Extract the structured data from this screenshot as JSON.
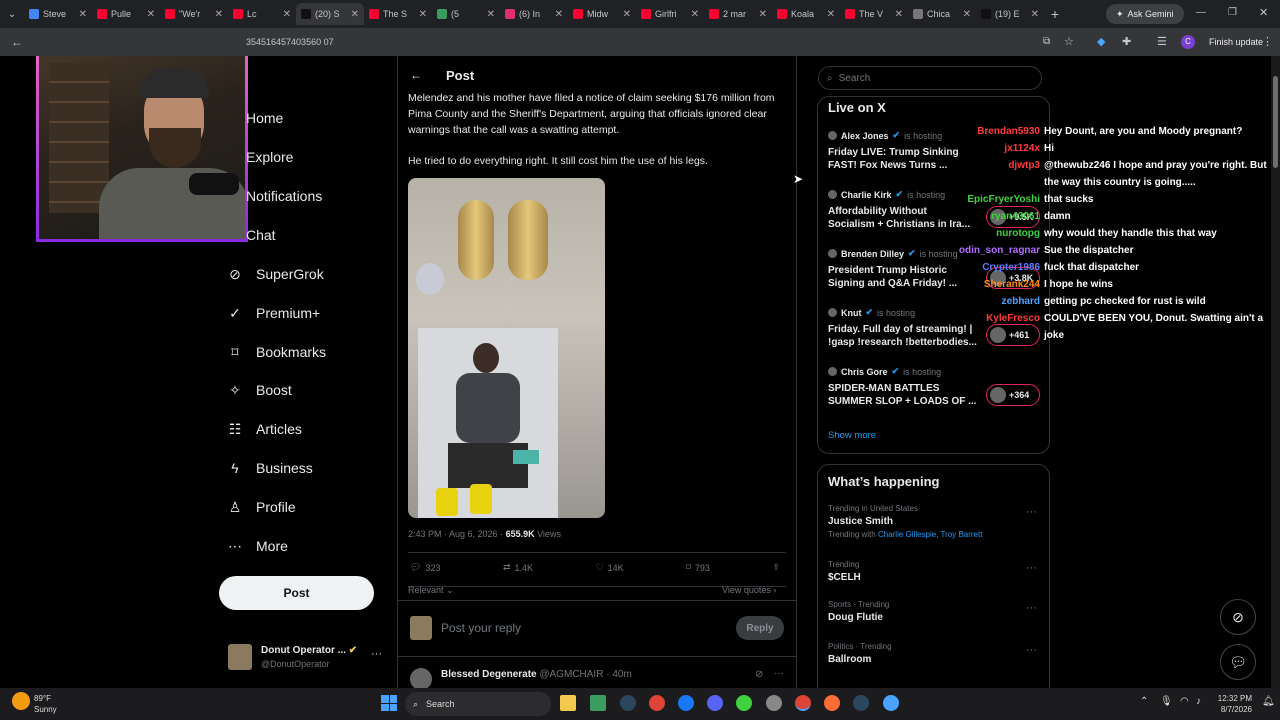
{
  "browser": {
    "tabs": [
      {
        "title": "Steve",
        "color": "#4285f4",
        "active": false
      },
      {
        "title": "Pulle",
        "color": "#ff0033",
        "active": false
      },
      {
        "title": "\"We'r",
        "color": "#ff0033",
        "active": false
      },
      {
        "title": "Lc",
        "color": "#ff0033",
        "active": false
      },
      {
        "title": "(20) S",
        "color": "#111111",
        "active": true
      },
      {
        "title": "The S",
        "color": "#ff0033",
        "active": false
      },
      {
        "title": "(5",
        "color": "#3a9d5d",
        "active": false
      },
      {
        "title": "(6) In",
        "color": "#e1306c",
        "active": false
      },
      {
        "title": "Midw",
        "color": "#ff0033",
        "active": false
      },
      {
        "title": "Girlfri",
        "color": "#ff0033",
        "active": false
      },
      {
        "title": "2 mar",
        "color": "#ff0033",
        "active": false
      },
      {
        "title": "Koala",
        "color": "#ff0033",
        "active": false
      },
      {
        "title": "The V",
        "color": "#ff0033",
        "active": false
      },
      {
        "title": "Chica",
        "color": "#777777",
        "active": false
      },
      {
        "title": "(19) E",
        "color": "#111111",
        "active": false
      }
    ],
    "ask_gemini": "Ask Gemini",
    "url": "354516457403560 07",
    "finish_update": "Finish update",
    "profile_initial": "C"
  },
  "sidebar": {
    "items": [
      {
        "label": "Home",
        "icon": "home-icon"
      },
      {
        "label": "Explore",
        "icon": "search-icon"
      },
      {
        "label": "Notifications",
        "icon": "bell-icon"
      },
      {
        "label": "Chat",
        "icon": "chat-icon"
      },
      {
        "label": "SuperGrok",
        "icon": "grok-icon"
      },
      {
        "label": "Premium+",
        "icon": "premium-icon"
      },
      {
        "label": "Bookmarks",
        "icon": "bookmark-icon"
      },
      {
        "label": "Boost",
        "icon": "boost-icon"
      },
      {
        "label": "Articles",
        "icon": "articles-icon"
      },
      {
        "label": "Business",
        "icon": "lightning-icon"
      },
      {
        "label": "Profile",
        "icon": "person-icon"
      },
      {
        "label": "More",
        "icon": "more-circle-icon"
      }
    ],
    "post_button": "Post",
    "account": {
      "name": "Donut Operator ...",
      "handle": "@DonutOperator"
    }
  },
  "post": {
    "header": "Post",
    "paragraph1": "Melendez and his mother have filed a notice of claim seeking $176 million from Pima County and the Sheriff's Department, arguing that officials ignored clear warnings that the call was a swatting attempt.",
    "paragraph2": "He tried to do everything right. It still cost him the use of his legs.",
    "time": "2:43 PM · Aug 6, 2026 · ",
    "views_count": "655.9K",
    "views_label": " Views",
    "replies": "323",
    "reposts": "1.4K",
    "likes": "14K",
    "bookmarks": "793",
    "sort": "Relevant",
    "view_quotes": "View quotes",
    "reply_placeholder": "Post your reply",
    "reply_button": "Reply",
    "reply_author": "Blessed Degenerate",
    "reply_handle": "@AGMCHAIR",
    "reply_time": "· 40m"
  },
  "right": {
    "search_placeholder": "Search",
    "live_title": "Live on X",
    "hosting_label": "is hosting",
    "live": [
      {
        "host": "Alex Jones",
        "title1": "Friday LIVE: Trump Sinking",
        "title2": "FAST! Fox News Turns ...",
        "count": ""
      },
      {
        "host": "Charlie Kirk",
        "title1": "Affordability Without",
        "title2": "Socialism + Christians in Ira...",
        "count": "+9.5K"
      },
      {
        "host": "Brenden Dilley",
        "title1": "President Trump Historic",
        "title2": "Signing and Q&A Friday! ...",
        "count": "+3.8K"
      },
      {
        "host": "Knut",
        "title1": "Friday. Full day of streaming! |",
        "title2": "!gasp !research !betterbodies...",
        "count": "+461"
      },
      {
        "host": "Chris Gore",
        "title1": "SPIDER-MAN BATTLES",
        "title2": "SUMMER SLOP + LOADS OF ...",
        "count": "+364"
      }
    ],
    "show_more": "Show more",
    "happening_title": "What’s happening",
    "trends": [
      {
        "meta": "Trending in United States",
        "name": "Justice Smith",
        "with_label": "Trending with",
        "with": "Charlie Gillespie, Troy Barrett"
      },
      {
        "meta": "Trending",
        "name": "$CELH"
      },
      {
        "meta": "Sports · Trending",
        "name": "Doug Flutie"
      },
      {
        "meta": "Politics · Trending",
        "name": "Ballroom"
      }
    ]
  },
  "chat_overlay": [
    {
      "user": "Brendan5930",
      "msg": "Hey Dount, are you and Moody pregnant?",
      "color": "#ff3b3b"
    },
    {
      "user": "jx1124x",
      "msg": "Hi",
      "color": "#ff3b3b"
    },
    {
      "user": "djwtp3",
      "msg": "@thewubz246 I hope and pray you're right. But",
      "color": "#ff3b3b"
    },
    {
      "user": "",
      "msg": "the way this country is going.....",
      "color": "#ffffff"
    },
    {
      "user": "EpicFryerYoshi",
      "msg": "that sucks",
      "color": "#3fd13f"
    },
    {
      "user": "ryan43061",
      "msg": "damn",
      "color": "#3fd13f"
    },
    {
      "user": "nurotopg",
      "msg": "why would they handle this that way",
      "color": "#3fd13f"
    },
    {
      "user": "odin_son_ragnar",
      "msg": "Sue the dispatcher",
      "color": "#b36bff"
    },
    {
      "user": "Crypter1986",
      "msg": "fuck that dispatcher",
      "color": "#5b7bff"
    },
    {
      "user": "Sherank244",
      "msg": "I hope he wins",
      "color": "#ff8c1a"
    },
    {
      "user": "zebhard",
      "msg": "getting pc checked for rust is wild",
      "color": "#4aa3ff"
    },
    {
      "user": "KyleFresco",
      "msg": "COULD'VE BEEN YOU, Donut. Swatting ain't a",
      "color": "#ff3b3b"
    },
    {
      "user": "",
      "msg": "joke",
      "color": "#ffffff"
    }
  ],
  "taskbar": {
    "temp": "89°F",
    "weather": "Sunny",
    "search": "Search",
    "time": "12:32 PM",
    "date": "8/7/2026"
  }
}
